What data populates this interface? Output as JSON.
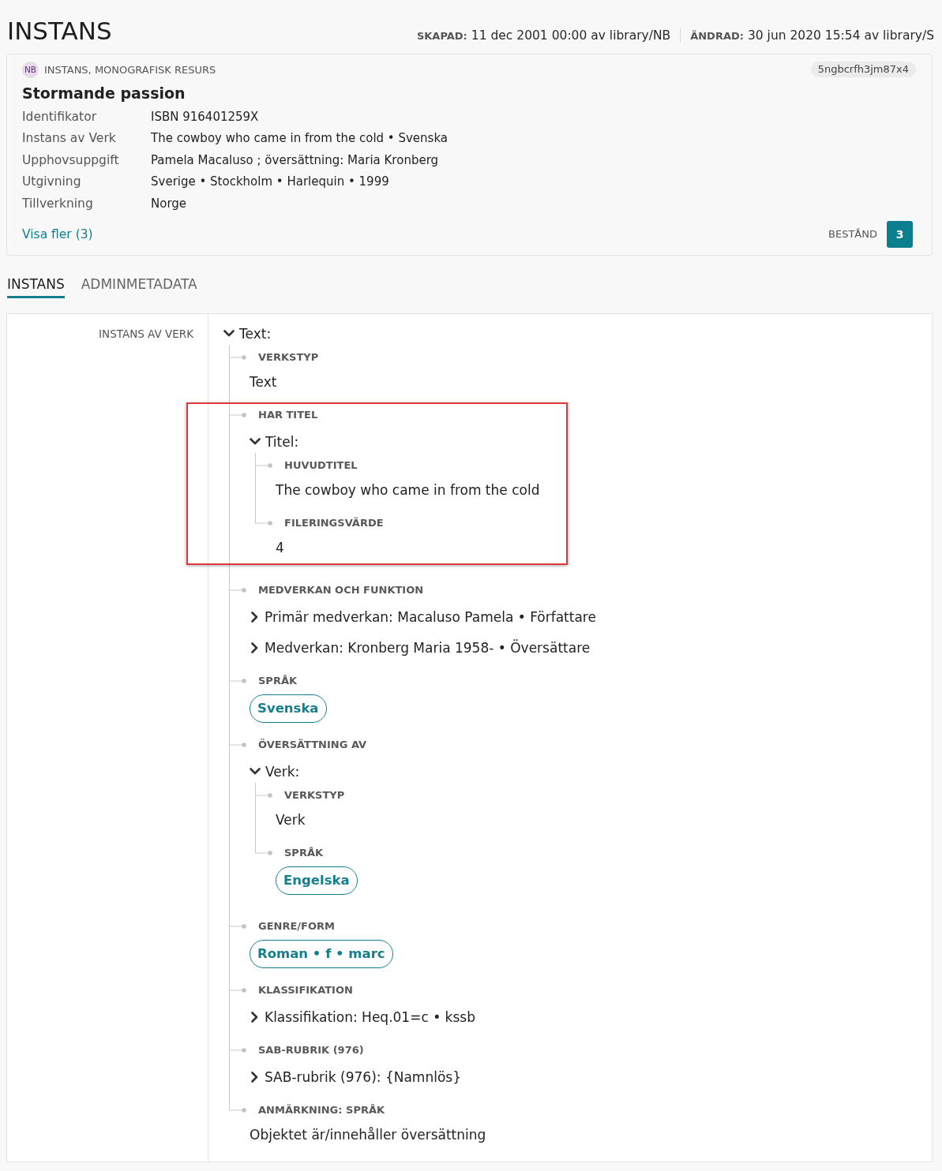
{
  "header": {
    "title": "INSTANS",
    "created_label": "SKAPAD:",
    "created": "11 dec 2001 00:00 av library/NB",
    "changed_label": "ÄNDRAD:",
    "changed": "30 jun 2020 15:54 av library/S"
  },
  "summary": {
    "source": "NB",
    "type": "INSTANS, MONOGRAFISK RESURS",
    "record_id": "5ngbcrfh3jm87x4",
    "title": "Stormande passion",
    "fields": [
      {
        "label": "Identifikator",
        "value": "ISBN 916401259X"
      },
      {
        "label": "Instans av Verk",
        "value": "The cowboy who came in from the cold • Svenska"
      },
      {
        "label": "Upphovsuppgift",
        "value": "Pamela Macaluso ; översättning: Maria Kronberg"
      },
      {
        "label": "Utgivning",
        "value": "Sverige • Stockholm • Harlequin • 1999"
      },
      {
        "label": "Tillverkning",
        "value": "Norge"
      }
    ],
    "show_more": "Visa fler (3)",
    "holdings_label": "BESTÅND",
    "holdings_count": "3"
  },
  "tabs": [
    {
      "label": "INSTANS",
      "selected": true
    },
    {
      "label": "ADMINMETADATA",
      "selected": false
    }
  ],
  "detail": {
    "label": "INSTANS AV VERK",
    "entity": {
      "kind": "entity",
      "label": "Text:",
      "expanded": true,
      "properties": [
        {
          "label": "VERKSTYP",
          "highlighted": false,
          "values": [
            {
              "kind": "text",
              "text": "Text"
            }
          ]
        },
        {
          "label": "HAR TITEL",
          "highlighted": true,
          "values": [
            {
              "kind": "entity",
              "label": "Titel:",
              "expanded": true,
              "properties": [
                {
                  "label": "HUVUDTITEL",
                  "values": [
                    {
                      "kind": "text",
                      "text": "The cowboy who came in from the cold"
                    }
                  ]
                },
                {
                  "label": "FILERINGSVÄRDE",
                  "values": [
                    {
                      "kind": "text",
                      "text": "4"
                    }
                  ]
                }
              ]
            }
          ]
        },
        {
          "label": "MEDVERKAN OCH FUNKTION",
          "highlighted": false,
          "values": [
            {
              "kind": "entity",
              "label": "Primär medverkan: Macaluso Pamela • Författare",
              "expanded": false
            },
            {
              "kind": "entity",
              "label": "Medverkan: Kronberg Maria 1958- • Översättare",
              "expanded": false
            }
          ]
        },
        {
          "label": "SPRÅK",
          "highlighted": false,
          "values": [
            {
              "kind": "link",
              "text": "Svenska"
            }
          ]
        },
        {
          "label": "ÖVERSÄTTNING AV",
          "highlighted": false,
          "values": [
            {
              "kind": "entity",
              "label": "Verk:",
              "expanded": true,
              "properties": [
                {
                  "label": "VERKSTYP",
                  "values": [
                    {
                      "kind": "text",
                      "text": "Verk"
                    }
                  ]
                },
                {
                  "label": "SPRÅK",
                  "values": [
                    {
                      "kind": "link",
                      "text": "Engelska"
                    }
                  ]
                }
              ]
            }
          ]
        },
        {
          "label": "GENRE/FORM",
          "highlighted": false,
          "values": [
            {
              "kind": "link",
              "text": "Roman • f • marc"
            }
          ]
        },
        {
          "label": "KLASSIFIKATION",
          "highlighted": false,
          "values": [
            {
              "kind": "entity",
              "label": "Klassifikation: Heq.01=c • kssb",
              "expanded": false
            }
          ]
        },
        {
          "label": "SAB-RUBRIK (976)",
          "highlighted": false,
          "values": [
            {
              "kind": "entity",
              "label": "SAB-rubrik (976): {Namnlös}",
              "expanded": false
            }
          ]
        },
        {
          "label": "ANMÄRKNING: SPRÅK",
          "highlighted": false,
          "values": [
            {
              "kind": "text",
              "text": "Objektet är/innehåller översättning"
            }
          ]
        }
      ]
    }
  }
}
